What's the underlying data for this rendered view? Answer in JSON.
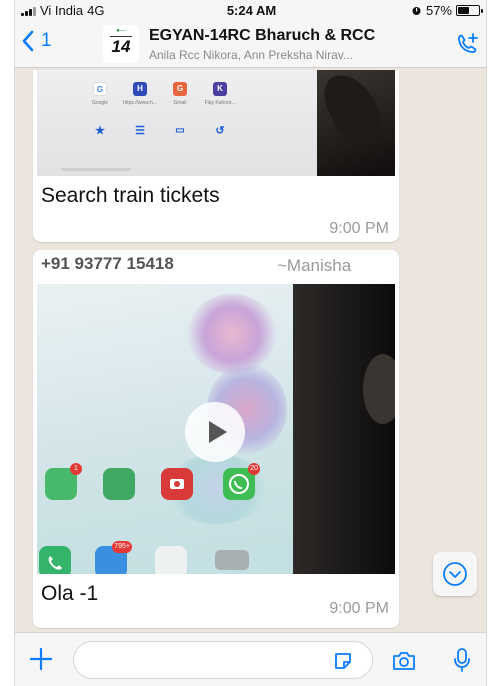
{
  "status": {
    "carrier": "Vi India",
    "network": "4G",
    "time": "5:24 AM",
    "battery": "57%",
    "battery_level": 0.57
  },
  "header": {
    "back_count": "1",
    "avatar_number": "14",
    "title": "EGYAN-14RC Bharuch & RCC",
    "subtitle": "Anila Rcc Nikora, Ann Preksha Nirav..."
  },
  "messages": [
    {
      "caption": "Search train tickets",
      "time": "9:00 PM",
      "apps": [
        {
          "letter": "G",
          "color": "#ffffff",
          "fg": "#4285f4",
          "label": "Google"
        },
        {
          "letter": "H",
          "color": "#2f4bb7",
          "fg": "#ffffff",
          "label": "https://www.h..."
        },
        {
          "letter": "G",
          "color": "#e8663d",
          "fg": "#ffffff",
          "label": "Gmail"
        },
        {
          "letter": "K",
          "color": "#4b3fa0",
          "fg": "#ffffff",
          "label": "Flay Kahoot..."
        }
      ]
    },
    {
      "sender_phone": "+91 93777 15418",
      "sender_name": "~Manisha",
      "caption": "Ola -1",
      "time": "9:00 PM",
      "badges": [
        "1",
        "20",
        "795+"
      ]
    }
  ],
  "composer": {
    "placeholder": ""
  },
  "icons": {
    "back": "chevron-left-icon",
    "call": "add-call-icon",
    "scroll": "chevron-down-icon",
    "attach": "plus-icon",
    "sticker": "sticker-icon",
    "camera": "camera-icon",
    "mic": "microphone-icon"
  },
  "colors": {
    "accent": "#0a7cff",
    "chat_bg": "#ece5dd",
    "bubble": "#ffffff",
    "timestamp": "#9a9a9a"
  }
}
